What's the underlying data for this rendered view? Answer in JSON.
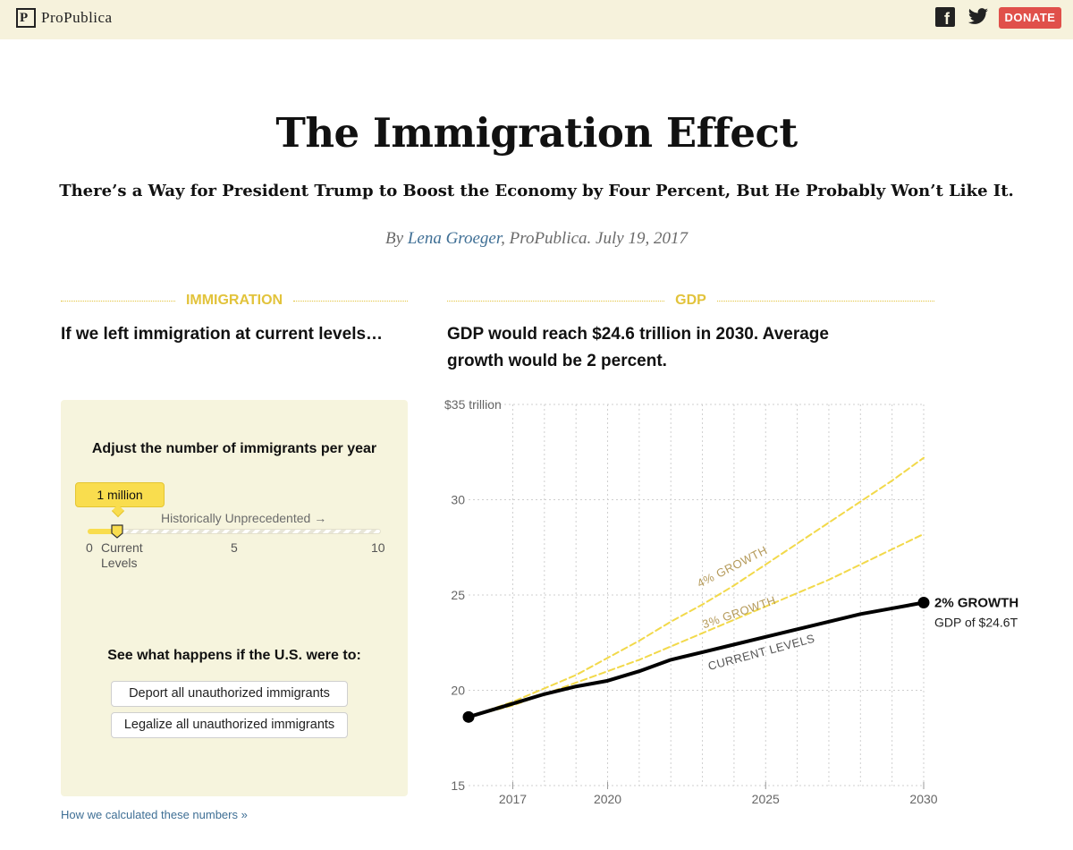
{
  "header": {
    "logo_mark": "P",
    "logo_text": "ProPublica",
    "facebook_glyph": "f",
    "donate_label": "DONATE",
    "background_color": "#f6f2dc",
    "donate_color": "#e0504a"
  },
  "article": {
    "title": "The Immigration Effect",
    "subtitle": "There’s a Way for President Trump to Boost the Economy by Four Percent, But He Probably Won’t Like It.",
    "byline_prefix": "By ",
    "author": "Lena Groeger",
    "byline_suffix": ", ProPublica. July 19, 2017"
  },
  "immigration": {
    "section_label": "IMMIGRATION",
    "lede": "If we left immigration at current levels…",
    "panel_title": "Adjust the number of immigrants per year",
    "slider_value_label": "1 million",
    "slider_value": 1,
    "slider_min": 0,
    "slider_max": 10,
    "historically_label": "Historically Unprecedented →",
    "tick_0": "0",
    "tick_current_1": "Current",
    "tick_current_2": "Levels",
    "tick_5": "5",
    "tick_10": "10",
    "see_what_label": "See what happens if the U.S. were to:",
    "deport_button": "Deport all unauthorized immigrants",
    "legalize_button": "Legalize all unauthorized immigrants",
    "how_link": "How we calculated these numbers »"
  },
  "gdp": {
    "section_label": "GDP",
    "lede_line_1": "GDP would reach $24.6 trillion in 2030. Average",
    "lede_line_2": "growth would be 2 percent."
  },
  "colors": {
    "accent_yellow": "#e2c33b",
    "line_yellow": "#f2d94a",
    "label_tan": "#b59a5a",
    "current_line": "#000000"
  },
  "chart_data": {
    "type": "line",
    "ylim": [
      15,
      35
    ],
    "xlim": [
      2015.6,
      2030
    ],
    "y_ticks": [
      15,
      20,
      25,
      30
    ],
    "y_tick_labels": [
      "15",
      "20",
      "25",
      "30"
    ],
    "y_top_label": "$35 trillion",
    "x_ticks": [
      2017,
      2020,
      2025,
      2030
    ],
    "x_tick_labels": [
      "2017",
      "2020",
      "2025",
      "2030"
    ],
    "grid": true,
    "series": [
      {
        "name": "4% GROWTH",
        "style": "dashed",
        "x": [
          2015.6,
          2017,
          2018,
          2019,
          2020,
          2021,
          2022,
          2023,
          2024,
          2025,
          2026,
          2027,
          2028,
          2029,
          2030
        ],
        "values": [
          18.6,
          19.4,
          20.1,
          20.8,
          21.7,
          22.6,
          23.6,
          24.5,
          25.5,
          26.6,
          27.7,
          28.8,
          29.9,
          31.0,
          32.2
        ]
      },
      {
        "name": "3% GROWTH",
        "style": "dashed",
        "x": [
          2015.6,
          2017,
          2018,
          2019,
          2020,
          2021,
          2022,
          2023,
          2024,
          2025,
          2026,
          2027,
          2028,
          2029,
          2030
        ],
        "values": [
          18.6,
          19.2,
          19.8,
          20.4,
          21.0,
          21.6,
          22.3,
          23.0,
          23.7,
          24.4,
          25.1,
          25.8,
          26.6,
          27.4,
          28.2
        ]
      },
      {
        "name": "CURRENT LEVELS",
        "style": "solid",
        "x": [
          2015.6,
          2017,
          2018,
          2019,
          2020,
          2021,
          2022,
          2023,
          2024,
          2025,
          2026,
          2027,
          2028,
          2029,
          2030
        ],
        "values": [
          18.6,
          19.3,
          19.8,
          20.2,
          20.5,
          21.0,
          21.6,
          22.0,
          22.4,
          22.8,
          23.2,
          23.6,
          24.0,
          24.3,
          24.6
        ]
      }
    ],
    "series_labels": [
      {
        "text": "4% GROWTH",
        "x": 2024.0,
        "y": 26.3,
        "angle": -27
      },
      {
        "text": "3% GROWTH",
        "x": 2024.2,
        "y": 23.9,
        "angle": -19
      },
      {
        "text": "CURRENT LEVELS",
        "x": 2024.9,
        "y": 21.8,
        "angle": -15
      }
    ],
    "endpoint_label": "2% GROWTH",
    "endpoint_sublabel": "GDP of $24.6T"
  }
}
